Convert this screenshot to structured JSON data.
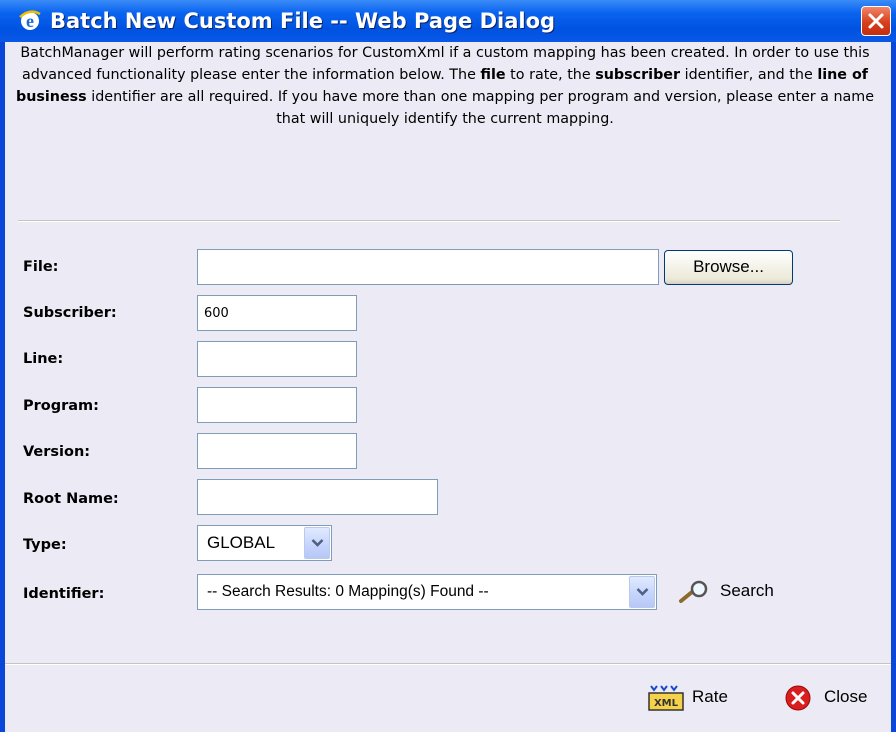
{
  "window": {
    "title": "Batch New Custom File -- Web Page Dialog",
    "icon": "ie-icon",
    "close_icon": "close-icon"
  },
  "intro": {
    "part1": "BatchManager will perform rating scenarios for CustomXml if a custom mapping has been created. In order to use this advanced functionality please enter the information below. The ",
    "bold1": "file",
    "part2": " to rate, the ",
    "bold2": "subscriber",
    "part3": " identifier, and the ",
    "bold3": "line of business",
    "part4": " identifier are all required. If you have more than one mapping per program and version, please enter a name that will uniquely identify the current mapping."
  },
  "form": {
    "file": {
      "label": "File:",
      "value": ""
    },
    "browse_label": "Browse...",
    "subscriber": {
      "label": "Subscriber:",
      "value": "600"
    },
    "line": {
      "label": "Line:",
      "value": ""
    },
    "program": {
      "label": "Program:",
      "value": ""
    },
    "version": {
      "label": "Version:",
      "value": ""
    },
    "root_name": {
      "label": "Root Name:",
      "value": ""
    },
    "type": {
      "label": "Type:",
      "value": "GLOBAL"
    },
    "identifier": {
      "label": "Identifier:",
      "value": "-- Search Results: 0 Mapping(s) Found --"
    },
    "search_label": "Search"
  },
  "actions": {
    "rate_label": "Rate",
    "close_label": "Close"
  },
  "colors": {
    "titlebar": "#0052e0",
    "client_bg": "#ecebf5",
    "input_border": "#7f9db9",
    "close_red": "#d8401c"
  }
}
